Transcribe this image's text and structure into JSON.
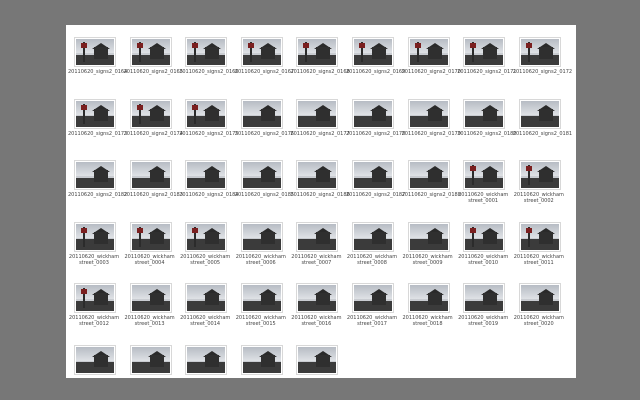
{
  "thumbnails": [
    {
      "caption": "20110620_signs2_0164",
      "kind": "sign"
    },
    {
      "caption": "20110620_signs2_0165",
      "kind": "sign"
    },
    {
      "caption": "20110620_signs2_0166",
      "kind": "sign"
    },
    {
      "caption": "20110620_signs2_0167",
      "kind": "sign"
    },
    {
      "caption": "20110620_signs2_0168",
      "kind": "sign"
    },
    {
      "caption": "20110620_signs2_0169",
      "kind": "sign"
    },
    {
      "caption": "20110620_signs2_0170",
      "kind": "sign"
    },
    {
      "caption": "20110620_signs2_0171",
      "kind": "sign"
    },
    {
      "caption": "20110620_signs2_0172",
      "kind": "sign"
    },
    {
      "caption": "20110620_signs2_0173",
      "kind": "sign"
    },
    {
      "caption": "20110620_signs2_0174",
      "kind": "sign"
    },
    {
      "caption": "20110620_signs2_0175",
      "kind": "sign"
    },
    {
      "caption": "20110620_signs2_0176",
      "kind": "house"
    },
    {
      "caption": "20110620_signs2_0177",
      "kind": "house"
    },
    {
      "caption": "20110620_signs2_0178",
      "kind": "house"
    },
    {
      "caption": "20110620_signs2_0179",
      "kind": "house"
    },
    {
      "caption": "20110620_signs2_0180",
      "kind": "house"
    },
    {
      "caption": "20110620_signs2_0181",
      "kind": "house"
    },
    {
      "caption": "20110620_signs2_0182",
      "kind": "house"
    },
    {
      "caption": "20110620_signs2_0183",
      "kind": "house"
    },
    {
      "caption": "20110620_signs2_0184",
      "kind": "house"
    },
    {
      "caption": "20110620_signs2_0185",
      "kind": "house"
    },
    {
      "caption": "20110620_signs2_0186",
      "kind": "house"
    },
    {
      "caption": "20110620_signs2_0187",
      "kind": "house"
    },
    {
      "caption": "20110620_signs2_0188",
      "kind": "house"
    },
    {
      "caption": "20110620_wickham\nstreet_0001",
      "kind": "sign"
    },
    {
      "caption": "20110620_wickham\nstreet_0002",
      "kind": "sign"
    },
    {
      "caption": "20110620_wickham\nstreet_0003",
      "kind": "sign"
    },
    {
      "caption": "20110620_wickham\nstreet_0004",
      "kind": "sign"
    },
    {
      "caption": "20110620_wickham\nstreet_0005",
      "kind": "sign"
    },
    {
      "caption": "20110620_wickham\nstreet_0006",
      "kind": "house"
    },
    {
      "caption": "20110620_wickham\nstreet_0007",
      "kind": "house"
    },
    {
      "caption": "20110620_wickham\nstreet_0008",
      "kind": "house"
    },
    {
      "caption": "20110620_wickham\nstreet_0009",
      "kind": "house"
    },
    {
      "caption": "20110620_wickham\nstreet_0010",
      "kind": "sign"
    },
    {
      "caption": "20110620_wickham\nstreet_0011",
      "kind": "sign"
    },
    {
      "caption": "20110620_wickham\nstreet_0012",
      "kind": "sign"
    },
    {
      "caption": "20110620_wickham\nstreet_0013",
      "kind": "house"
    },
    {
      "caption": "20110620_wickham\nstreet_0014",
      "kind": "house"
    },
    {
      "caption": "20110620_wickham\nstreet_0015",
      "kind": "house"
    },
    {
      "caption": "20110620_wickham\nstreet_0016",
      "kind": "house"
    },
    {
      "caption": "20110620_wickham\nstreet_0017",
      "kind": "house"
    },
    {
      "caption": "20110620_wickham\nstreet_0018",
      "kind": "house"
    },
    {
      "caption": "20110620_wickham\nstreet_0019",
      "kind": "house"
    },
    {
      "caption": "20110620_wickham\nstreet_0020",
      "kind": "house"
    },
    {
      "caption": "",
      "kind": "house"
    },
    {
      "caption": "",
      "kind": "house"
    },
    {
      "caption": "",
      "kind": "house"
    },
    {
      "caption": "",
      "kind": "house"
    },
    {
      "caption": "",
      "kind": "house"
    }
  ]
}
